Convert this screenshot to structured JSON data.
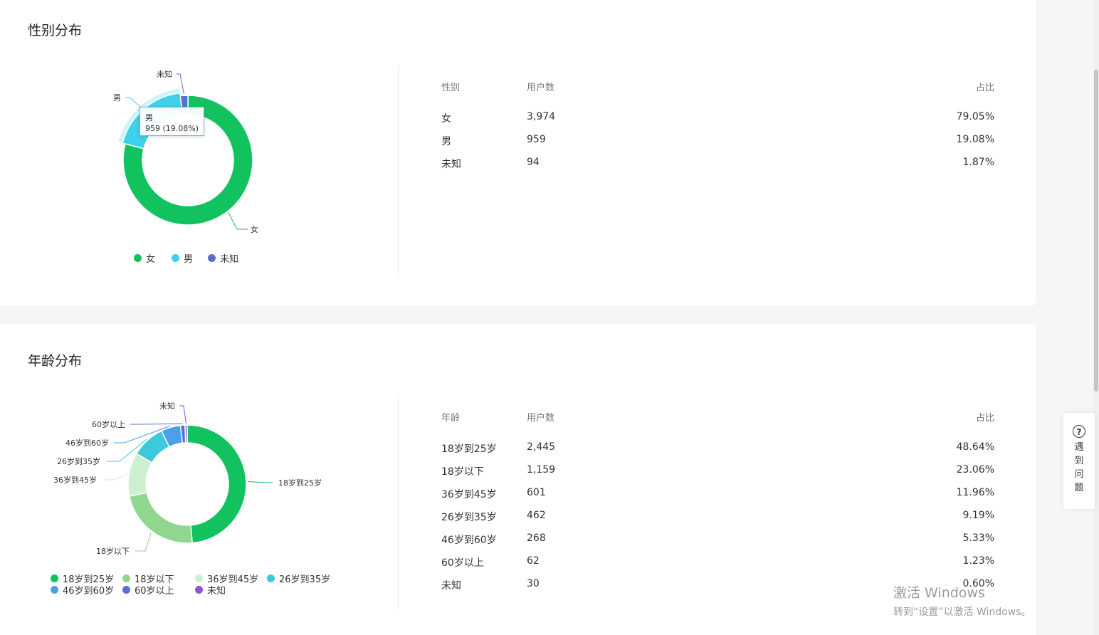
{
  "gender": {
    "title": "性别分布",
    "chart_data": {
      "type": "pie",
      "categories": [
        "女",
        "男",
        "未知"
      ],
      "values": [
        3974,
        959,
        94
      ],
      "colors": [
        "#12c25f",
        "#3fd0ea",
        "#5b6fd0"
      ],
      "legend": "bottom"
    },
    "tooltip": {
      "name": "男",
      "value": "959 (19.08%)"
    },
    "table": {
      "headers": [
        "性别",
        "用户数",
        "占比"
      ],
      "rows": [
        [
          "女",
          "3,974",
          "79.05%"
        ],
        [
          "男",
          "959",
          "19.08%"
        ],
        [
          "未知",
          "94",
          "1.87%"
        ]
      ]
    }
  },
  "age": {
    "title": "年龄分布",
    "chart_data": {
      "type": "pie",
      "categories": [
        "18岁到25岁",
        "18岁以下",
        "36岁到45岁",
        "26岁到35岁",
        "46岁到60岁",
        "60岁以上",
        "未知"
      ],
      "values": [
        2445,
        1159,
        601,
        462,
        268,
        62,
        30
      ],
      "colors": [
        "#12c25f",
        "#8fd68f",
        "#cdeed0",
        "#3cc8dd",
        "#4aa0ea",
        "#5b6fd0",
        "#8a55d6"
      ],
      "legend": "bottom"
    },
    "table": {
      "headers": [
        "年龄",
        "用户数",
        "占比"
      ],
      "rows": [
        [
          "18岁到25岁",
          "2,445",
          "48.64%"
        ],
        [
          "18岁以下",
          "1,159",
          "23.06%"
        ],
        [
          "36岁到45岁",
          "601",
          "11.96%"
        ],
        [
          "26岁到35岁",
          "462",
          "9.19%"
        ],
        [
          "46岁到60岁",
          "268",
          "5.33%"
        ],
        [
          "60岁以上",
          "62",
          "1.23%"
        ],
        [
          "未知",
          "30",
          "0.60%"
        ]
      ]
    }
  },
  "help": {
    "label": "遇到问题",
    "icon": "question-circle-icon"
  },
  "watermark": {
    "line1": "激活 Windows",
    "line2": "转到“设置”以激活 Windows。"
  }
}
